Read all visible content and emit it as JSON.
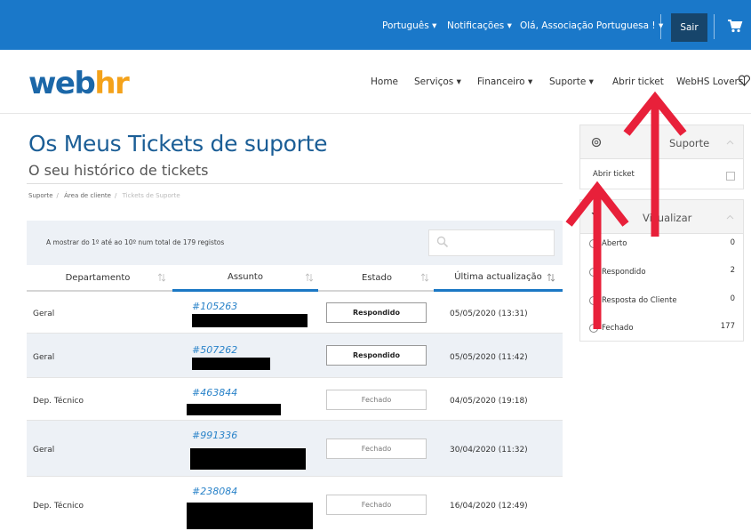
{
  "topbar": {
    "language": "Português",
    "notifications": "Notificações",
    "greeting": "Olá, Associação Portuguesa !",
    "logout": "Sair"
  },
  "logo": {
    "part1": "web",
    "part2": "hr"
  },
  "nav": {
    "home": "Home",
    "services": "Serviços",
    "finance": "Financeiro",
    "support": "Suporte",
    "open_ticket": "Abrir ticket",
    "lovers": "WebHS Lovers"
  },
  "page": {
    "title": "Os Meus Tickets de suporte",
    "subtitle": "O seu histórico de tickets"
  },
  "breadcrumb": [
    "Suporte",
    "Área de cliente",
    "Tickets de Suporte"
  ],
  "table": {
    "info": "A mostrar do 1º até ao 10º num total de 179 registos",
    "columns": [
      "Departamento",
      "Assunto",
      "Estado",
      "Última actualização"
    ],
    "rows": [
      {
        "department": "Geral",
        "ticket": "#105263",
        "status": "Respondido",
        "updated": "05/05/2020 (13:31)"
      },
      {
        "department": "Geral",
        "ticket": "#507262",
        "status": "Respondido",
        "updated": "05/05/2020 (11:42)"
      },
      {
        "department": "Dep. Técnico",
        "ticket": "#463844",
        "status": "Fechado",
        "updated": "04/05/2020 (19:18)"
      },
      {
        "department": "Geral",
        "ticket": "#991336",
        "status": "Fechado",
        "updated": "30/04/2020 (11:32)"
      },
      {
        "department": "Dep. Técnico",
        "ticket": "#238084",
        "status": "Fechado",
        "updated": "16/04/2020 (12:49)"
      }
    ]
  },
  "sidebar": {
    "support_title": "Suporte",
    "support_item": "Abrir ticket",
    "filter_title": "Visualizar",
    "filters": [
      {
        "label": "Aberto",
        "count": "0"
      },
      {
        "label": "Respondido",
        "count": "2"
      },
      {
        "label": "Resposta do Cliente",
        "count": "0"
      },
      {
        "label": "Fechado",
        "count": "177"
      }
    ]
  },
  "colors": {
    "topbar": "#1a78c9",
    "brand_blue": "#1b67a8",
    "brand_orange": "#f4a21a",
    "link": "#2a83c9",
    "annotation_red": "#e8203a"
  }
}
